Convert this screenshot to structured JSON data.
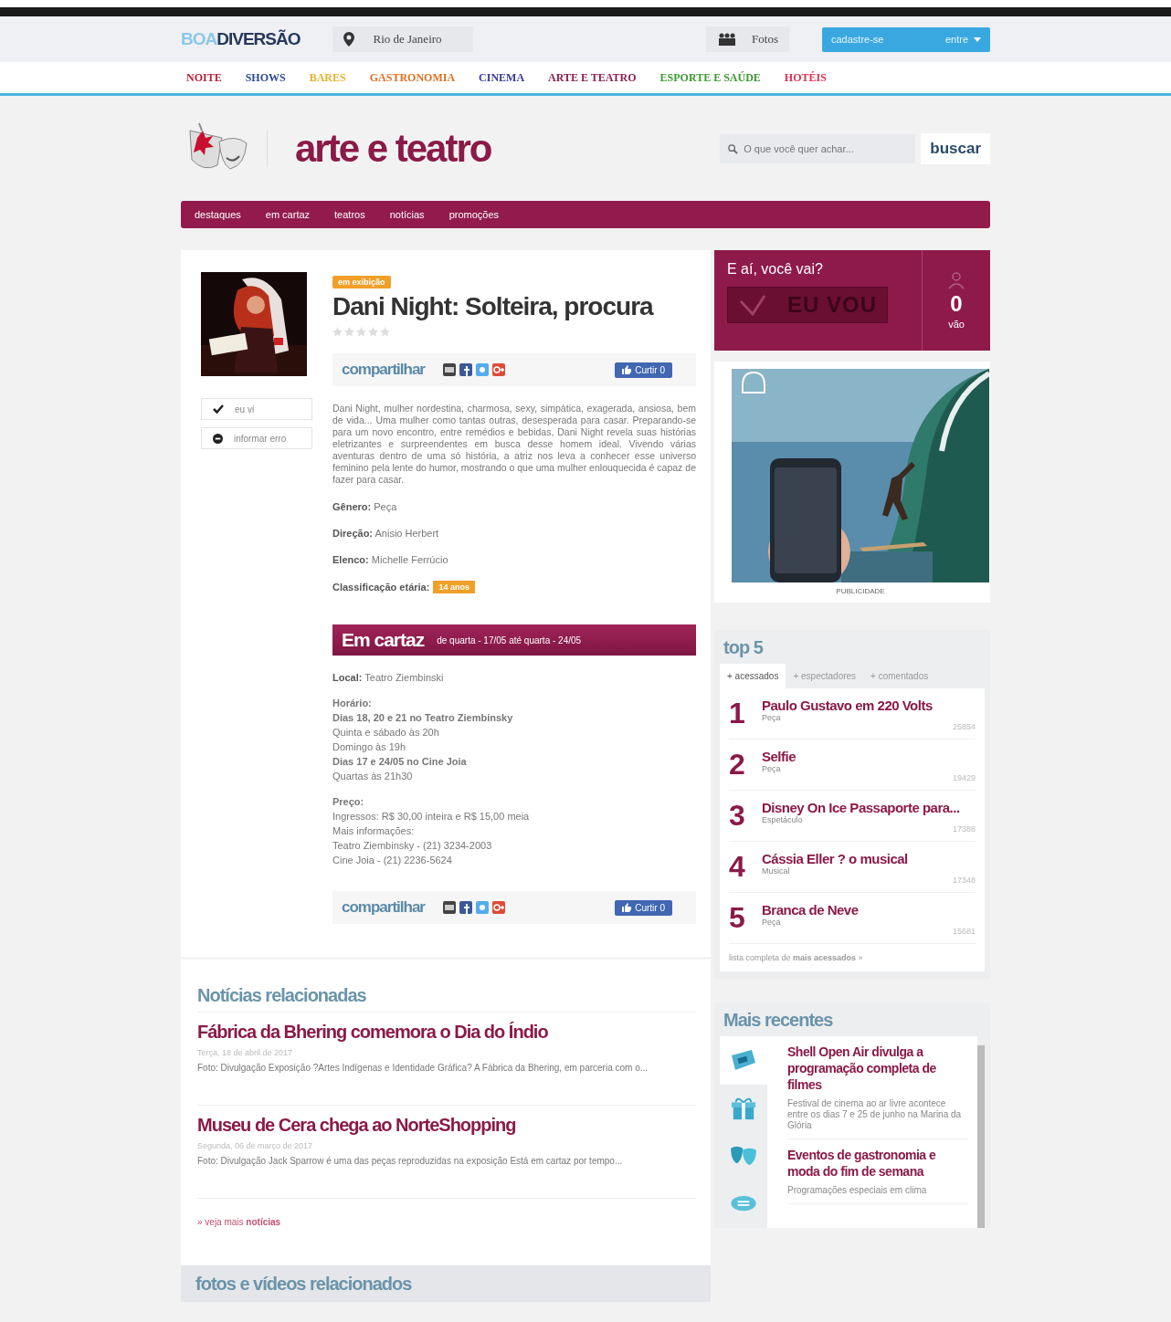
{
  "header": {
    "logo": {
      "part1": "BOA",
      "part2": "DIVERSÃO"
    },
    "location": "Rio de Janeiro",
    "photos_link": "Fotos",
    "signup_button": "cadastre-se",
    "login_button": "entre"
  },
  "categories": [
    {
      "label": "NOITE",
      "color": "#b8203a"
    },
    {
      "label": "SHOWS",
      "color": "#2a4a9a"
    },
    {
      "label": "BARES",
      "color": "#e8b030"
    },
    {
      "label": "GASTRONOMIA",
      "color": "#e07020"
    },
    {
      "label": "CINEMA",
      "color": "#3a3a9a"
    },
    {
      "label": "ARTE E TEATRO",
      "color": "#8a2050"
    },
    {
      "label": "ESPORTE E SAÚDE",
      "color": "#3a9a30"
    },
    {
      "label": "HOTÉIS",
      "color": "#e03050"
    }
  ],
  "section": {
    "title": "arte e teatro",
    "search_placeholder": "O que você quer achar...",
    "search_button": "buscar"
  },
  "subnav": [
    "destaques",
    "em cartaz",
    "teatros",
    "notícias",
    "promoções"
  ],
  "event": {
    "status_badge": "em exibição",
    "title": "Dani Night: Solteira, procura",
    "stars": 0,
    "side_buttons": [
      {
        "kind": "check",
        "label": "eu vi"
      },
      {
        "kind": "error",
        "label": "informar erro"
      }
    ],
    "share": {
      "label": "compartilhar",
      "like_button": "Curtir 0"
    },
    "description": "Dani Night, mulher nordestina, charmosa, sexy, simpática, exagerada, ansiosa, bem de vida... Uma mulher como tantas outras, desesperada para casar. Preparando-se para um novo encontro, entre remédios e bebidas, Dani Night revela suas histórias eletrizantes e surpreendentes em busca desse homem ideal. Vivendo várias aventuras dentro de uma só história, a atriz nos leva a conhecer esse universo feminino pela lente do humor, mostrando o que uma mulher enlouquecida é capaz de fazer para casar.",
    "details": [
      {
        "label": "Gênero:",
        "value": "Peça"
      },
      {
        "label": "Direção:",
        "value": "Anisio Herbert"
      },
      {
        "label": "Elenco:",
        "value": "Michelle Ferrúcio"
      }
    ],
    "rating": {
      "label": "Classificação etária:",
      "badge": "14 anos"
    },
    "schedule": {
      "title": "Em cartaz",
      "dates": "de quarta - 17/05 até quarta - 24/05",
      "local_label": "Local:",
      "local": "Teatro Ziembinski",
      "hours_label": "Horário:",
      "hours": [
        {
          "text": "Dias 18, 20 e 21 no Teatro Ziembinsky",
          "bold": true
        },
        {
          "text": "Quinta e sábado às 20h",
          "bold": false
        },
        {
          "text": "Domingo às 19h",
          "bold": false
        },
        {
          "text": "Dias 17 e 24/05 no Cine Joia",
          "bold": true
        },
        {
          "text": "Quartas às 21h30",
          "bold": false
        }
      ],
      "price_label": "Preço:",
      "price": [
        "Ingressos: R$ 30,00 inteira e R$ 15,00 meia",
        "Mais informações:",
        "Teatro Ziembinsky - (21) 3234-2003",
        "Cine Joia - (21) 2236-5624"
      ]
    },
    "share_bottom": {
      "label": "compartilhar",
      "like_button": "Curtir 0"
    }
  },
  "related_news": {
    "title": "Notícias relacionadas",
    "items": [
      {
        "title": "Fábrica da Bhering comemora o Dia do Índio",
        "date": "Terça, 18 de abril de 2017",
        "summary": "Foto: Divulgação Exposição ?Artes Indígenas e Identidade Gráfica? A Fábrica da Bhering, em parceria com o..."
      },
      {
        "title": "Museu de Cera chega ao NorteShopping",
        "date": "Segunda, 06 de março de 2017",
        "summary": "Foto: Divulgação Jack Sparrow é uma das peças reproduzidas na exposição Está em cartaz por tempo..."
      }
    ],
    "more_link": "» veja mais **notícias**"
  },
  "related_media": {
    "title": "fotos e vídeos relacionados"
  },
  "attendance": {
    "question": "E aí, você vai?",
    "button": "EU VOU",
    "count": "0",
    "count_label": "vão"
  },
  "ad": {
    "kind": "picture",
    "caption": "PUBLICIDADE"
  },
  "top5": {
    "title": "top 5",
    "tabs": [
      {
        "label": "+ acessados",
        "selected": true
      },
      {
        "label": "+ espectadores",
        "selected": false
      },
      {
        "label": "+ comentados",
        "selected": false
      }
    ],
    "items": [
      {
        "rank": "1",
        "title": "Paulo Gustavo em 220 Volts",
        "category": "Peça",
        "views": "25854"
      },
      {
        "rank": "2",
        "title": "Selfie",
        "category": "Peça",
        "views": "19429"
      },
      {
        "rank": "3",
        "title": "Disney On Ice Passaporte para...",
        "category": "Espetáculo",
        "views": "17388"
      },
      {
        "rank": "4",
        "title": "Cássia Eller ? o musical",
        "category": "Musical",
        "views": "17348"
      },
      {
        "rank": "5",
        "title": "Branca de Neve",
        "category": "Peça",
        "views": "15681"
      }
    ],
    "footer": "lista completa de **mais acessados** »"
  },
  "recent": {
    "title": "Mais recentes",
    "categories": [
      {
        "kind": "news",
        "selected": true
      },
      {
        "kind": "gift",
        "selected": false
      },
      {
        "kind": "masks",
        "selected": false
      },
      {
        "kind": "chat",
        "selected": false
      }
    ],
    "items": [
      {
        "title": "Shell Open Air divulga a programação completa de filmes",
        "summary": "Festival de cinema ao ar livre acontece entre os dias 7 e 25 de junho na Marina da Glória"
      },
      {
        "title": "Eventos de gastronomia e moda do fim de semana",
        "summary": "Programações especiais em clima"
      }
    ]
  }
}
